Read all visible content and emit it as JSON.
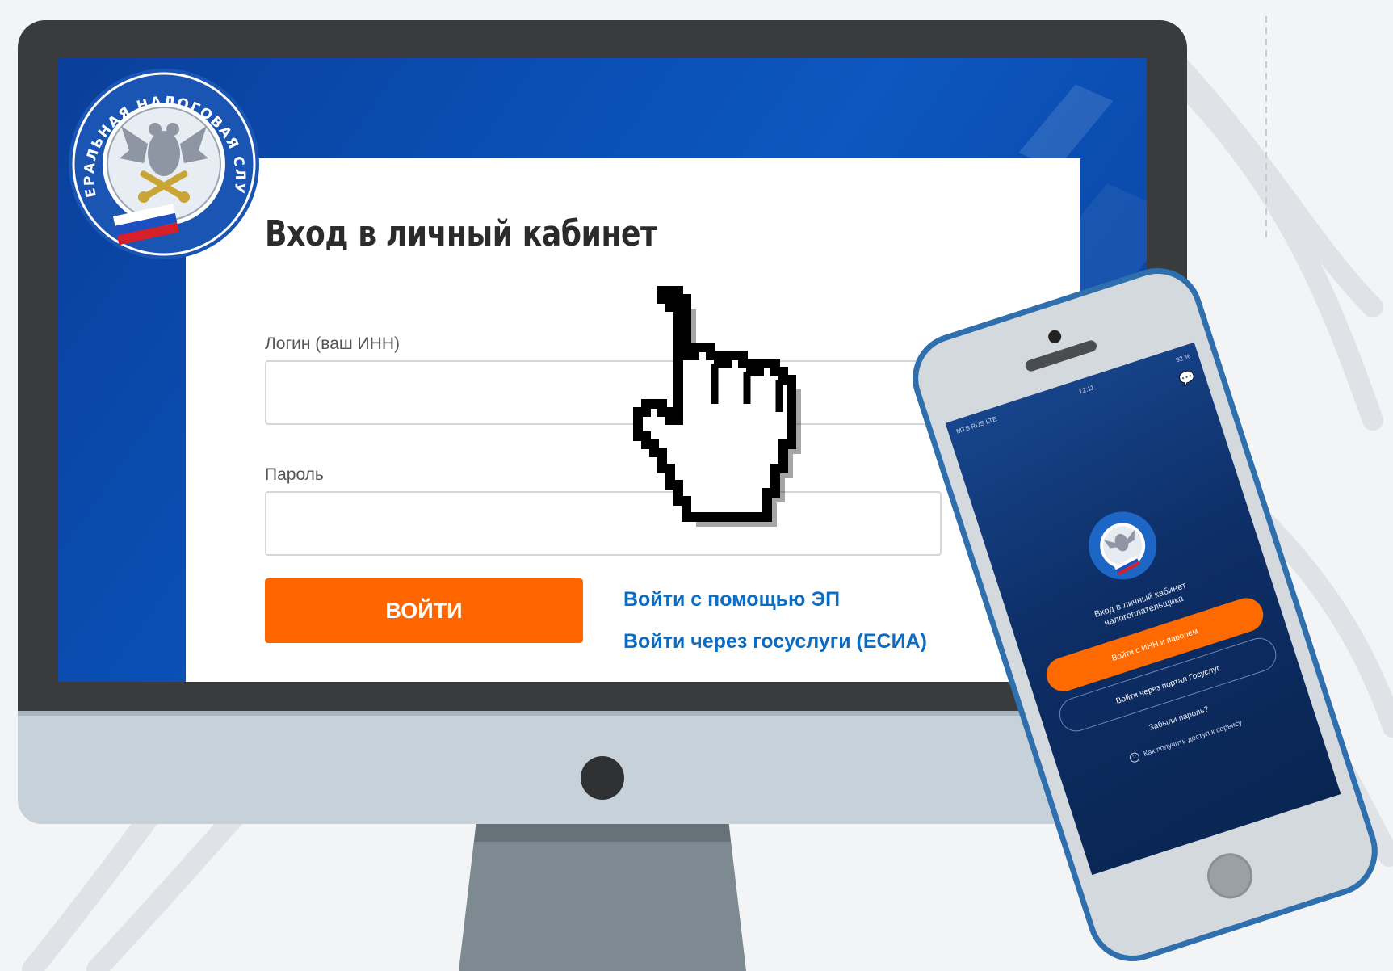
{
  "desktop": {
    "emblem_text": "ФЕДЕРАЛЬНАЯ НАЛОГОВАЯ СЛУЖБА",
    "title": "Вход в личный кабинет",
    "login_label": "Логин (ваш ИНН)",
    "login_value": "",
    "password_label": "Пароль",
    "password_value": "",
    "submit_label": "ВОЙТИ",
    "link_ep": "Войти с помощью ЭП",
    "link_esia": "Войти через госуслуги (ЕСИА)"
  },
  "phone": {
    "status_carrier": "MTS RUS LTE",
    "status_time": "12:11",
    "status_battery": "92 %",
    "title_line1": "Вход в личный кабинет",
    "title_line2": "налогоплательщика",
    "btn_primary": "Войти с ИНН и паролем",
    "btn_outline": "Войти через портал Госуслуг",
    "forgot": "Забыли пароль?",
    "help": "Как получить доступ к сервису"
  },
  "colors": {
    "accent_orange": "#ff6600",
    "link_blue": "#0b6cc4",
    "screen_blue": "#0a4fb4"
  },
  "icons": [
    "emblem-icon",
    "hand-cursor-icon",
    "chat-icon",
    "info-icon"
  ]
}
